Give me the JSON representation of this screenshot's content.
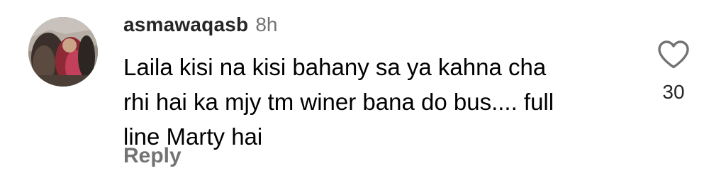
{
  "comment": {
    "avatar_icon": "user-avatar-photo",
    "username": "asmawaqasb",
    "timestamp": "8h",
    "text": "Laila kisi na kisi bahany sa ya kahna cha\nrhi hai ka mjy tm winer bana do bus.... full\nline Marty hai",
    "reply_label": "Reply",
    "like_icon": "heart-outline-icon",
    "like_count": "30"
  },
  "colors": {
    "username": "#262626",
    "secondary_text": "#737373",
    "body_text": "#000000",
    "background": "#ffffff"
  }
}
